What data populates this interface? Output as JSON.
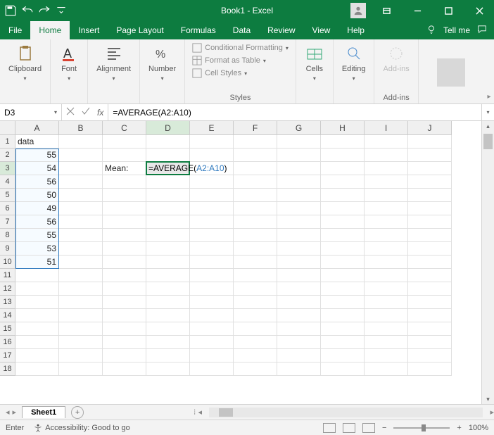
{
  "title": "Book1 - Excel",
  "tabs": [
    "File",
    "Home",
    "Insert",
    "Page Layout",
    "Formulas",
    "Data",
    "Review",
    "View",
    "Help"
  ],
  "tellme": "Tell me",
  "ribbon": {
    "clipboard": "Clipboard",
    "font": "Font",
    "alignment": "Alignment",
    "number": "Number",
    "cond_format": "Conditional Formatting",
    "as_table": "Format as Table",
    "cell_styles": "Cell Styles",
    "styles": "Styles",
    "cells": "Cells",
    "editing": "Editing",
    "addins": "Add-ins"
  },
  "namebox": "D3",
  "formula": "=AVERAGE(A2:A10)",
  "columns": [
    "A",
    "B",
    "C",
    "D",
    "E",
    "F",
    "G",
    "H",
    "I",
    "J"
  ],
  "rows": 18,
  "cells": {
    "A1": "data",
    "A2": "55",
    "A3": "54",
    "A4": "56",
    "A5": "50",
    "A6": "49",
    "A7": "56",
    "A8": "55",
    "A9": "53",
    "A10": "51",
    "C3": "Mean:"
  },
  "editing_cell": {
    "text_pre": "=AVERAGE(",
    "ref": "A2:A10",
    "text_post": ")"
  },
  "sheet": "Sheet1",
  "status_mode": "Enter",
  "accessibility": "Accessibility: Good to go",
  "zoom": "100%"
}
